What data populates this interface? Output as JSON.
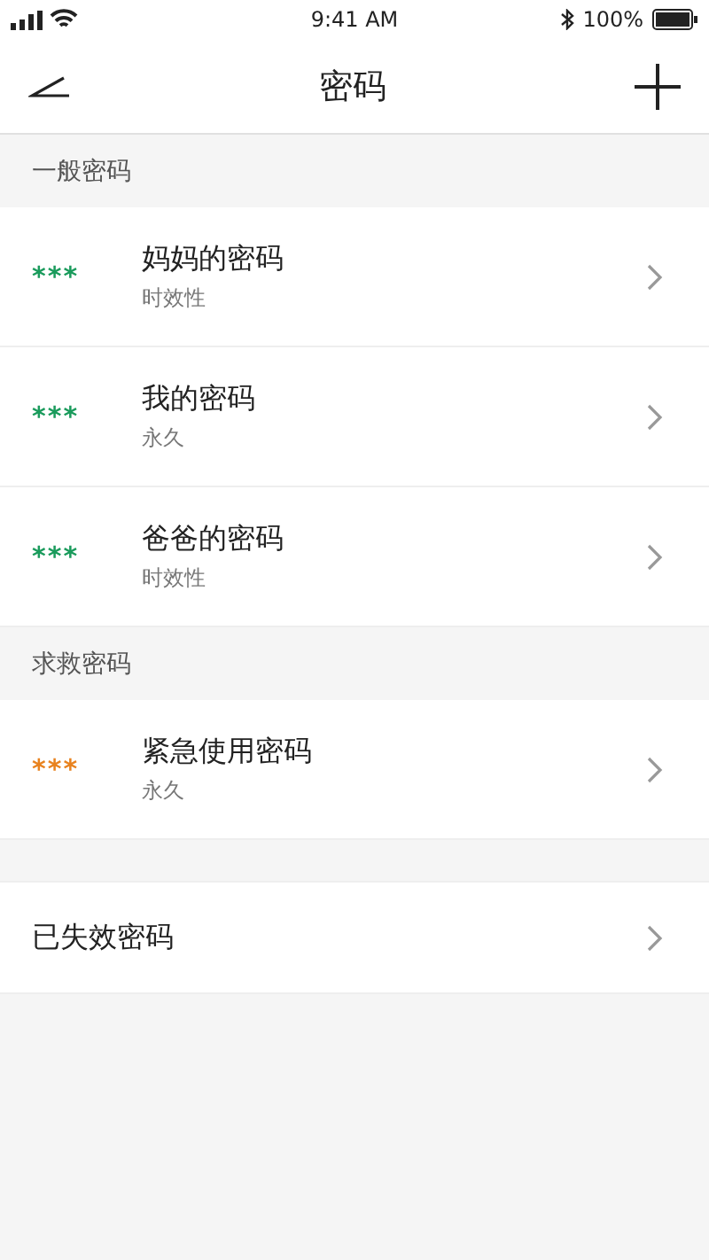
{
  "status_bar": {
    "time": "9:41 AM",
    "battery": "100%"
  },
  "nav": {
    "title": "密码"
  },
  "sections": [
    {
      "header": "一般密码",
      "items": [
        {
          "mask": "***",
          "color": "#1a9b5c",
          "name": "妈妈的密码",
          "subtitle": "时效性"
        },
        {
          "mask": "***",
          "color": "#1a9b5c",
          "name": "我的密码",
          "subtitle": "永久"
        },
        {
          "mask": "***",
          "color": "#1a9b5c",
          "name": "爸爸的密码",
          "subtitle": "时效性"
        }
      ]
    },
    {
      "header": "求救密码",
      "items": [
        {
          "mask": "***",
          "color": "#e8821e",
          "name": "紧急使用密码",
          "subtitle": "永久"
        }
      ]
    }
  ],
  "expired": {
    "label": "已失效密码"
  }
}
